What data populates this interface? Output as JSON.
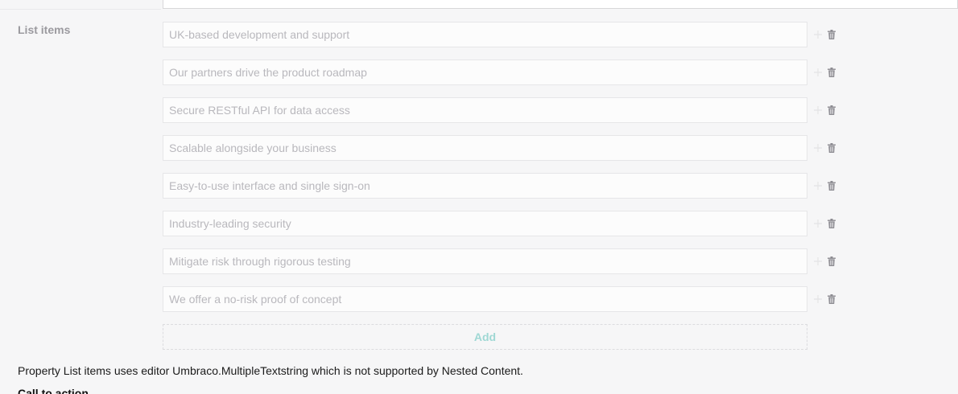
{
  "property": {
    "label": "List items"
  },
  "list_items": [
    "UK-based development and support",
    "Our partners drive the product roadmap",
    "Secure RESTful API for data access",
    "Scalable alongside your business",
    "Easy-to-use interface and single sign-on",
    "Industry-leading security",
    "Mitigate risk through rigorous testing",
    "We offer a no-risk proof of concept"
  ],
  "icons": {
    "move": "move-handle-icon",
    "delete": "trash-icon"
  },
  "add_button": {
    "label": "Add"
  },
  "warning": {
    "text": "Property List items uses editor Umbraco.MultipleTextstring which is not supported by Nested Content."
  },
  "next_property": {
    "label": "Call to action"
  },
  "colors": {
    "add_text": "#9fd8d4",
    "label": "#9b9a9f",
    "placeholder_text": "#b9b8bd",
    "icon": "#8d8c92"
  }
}
